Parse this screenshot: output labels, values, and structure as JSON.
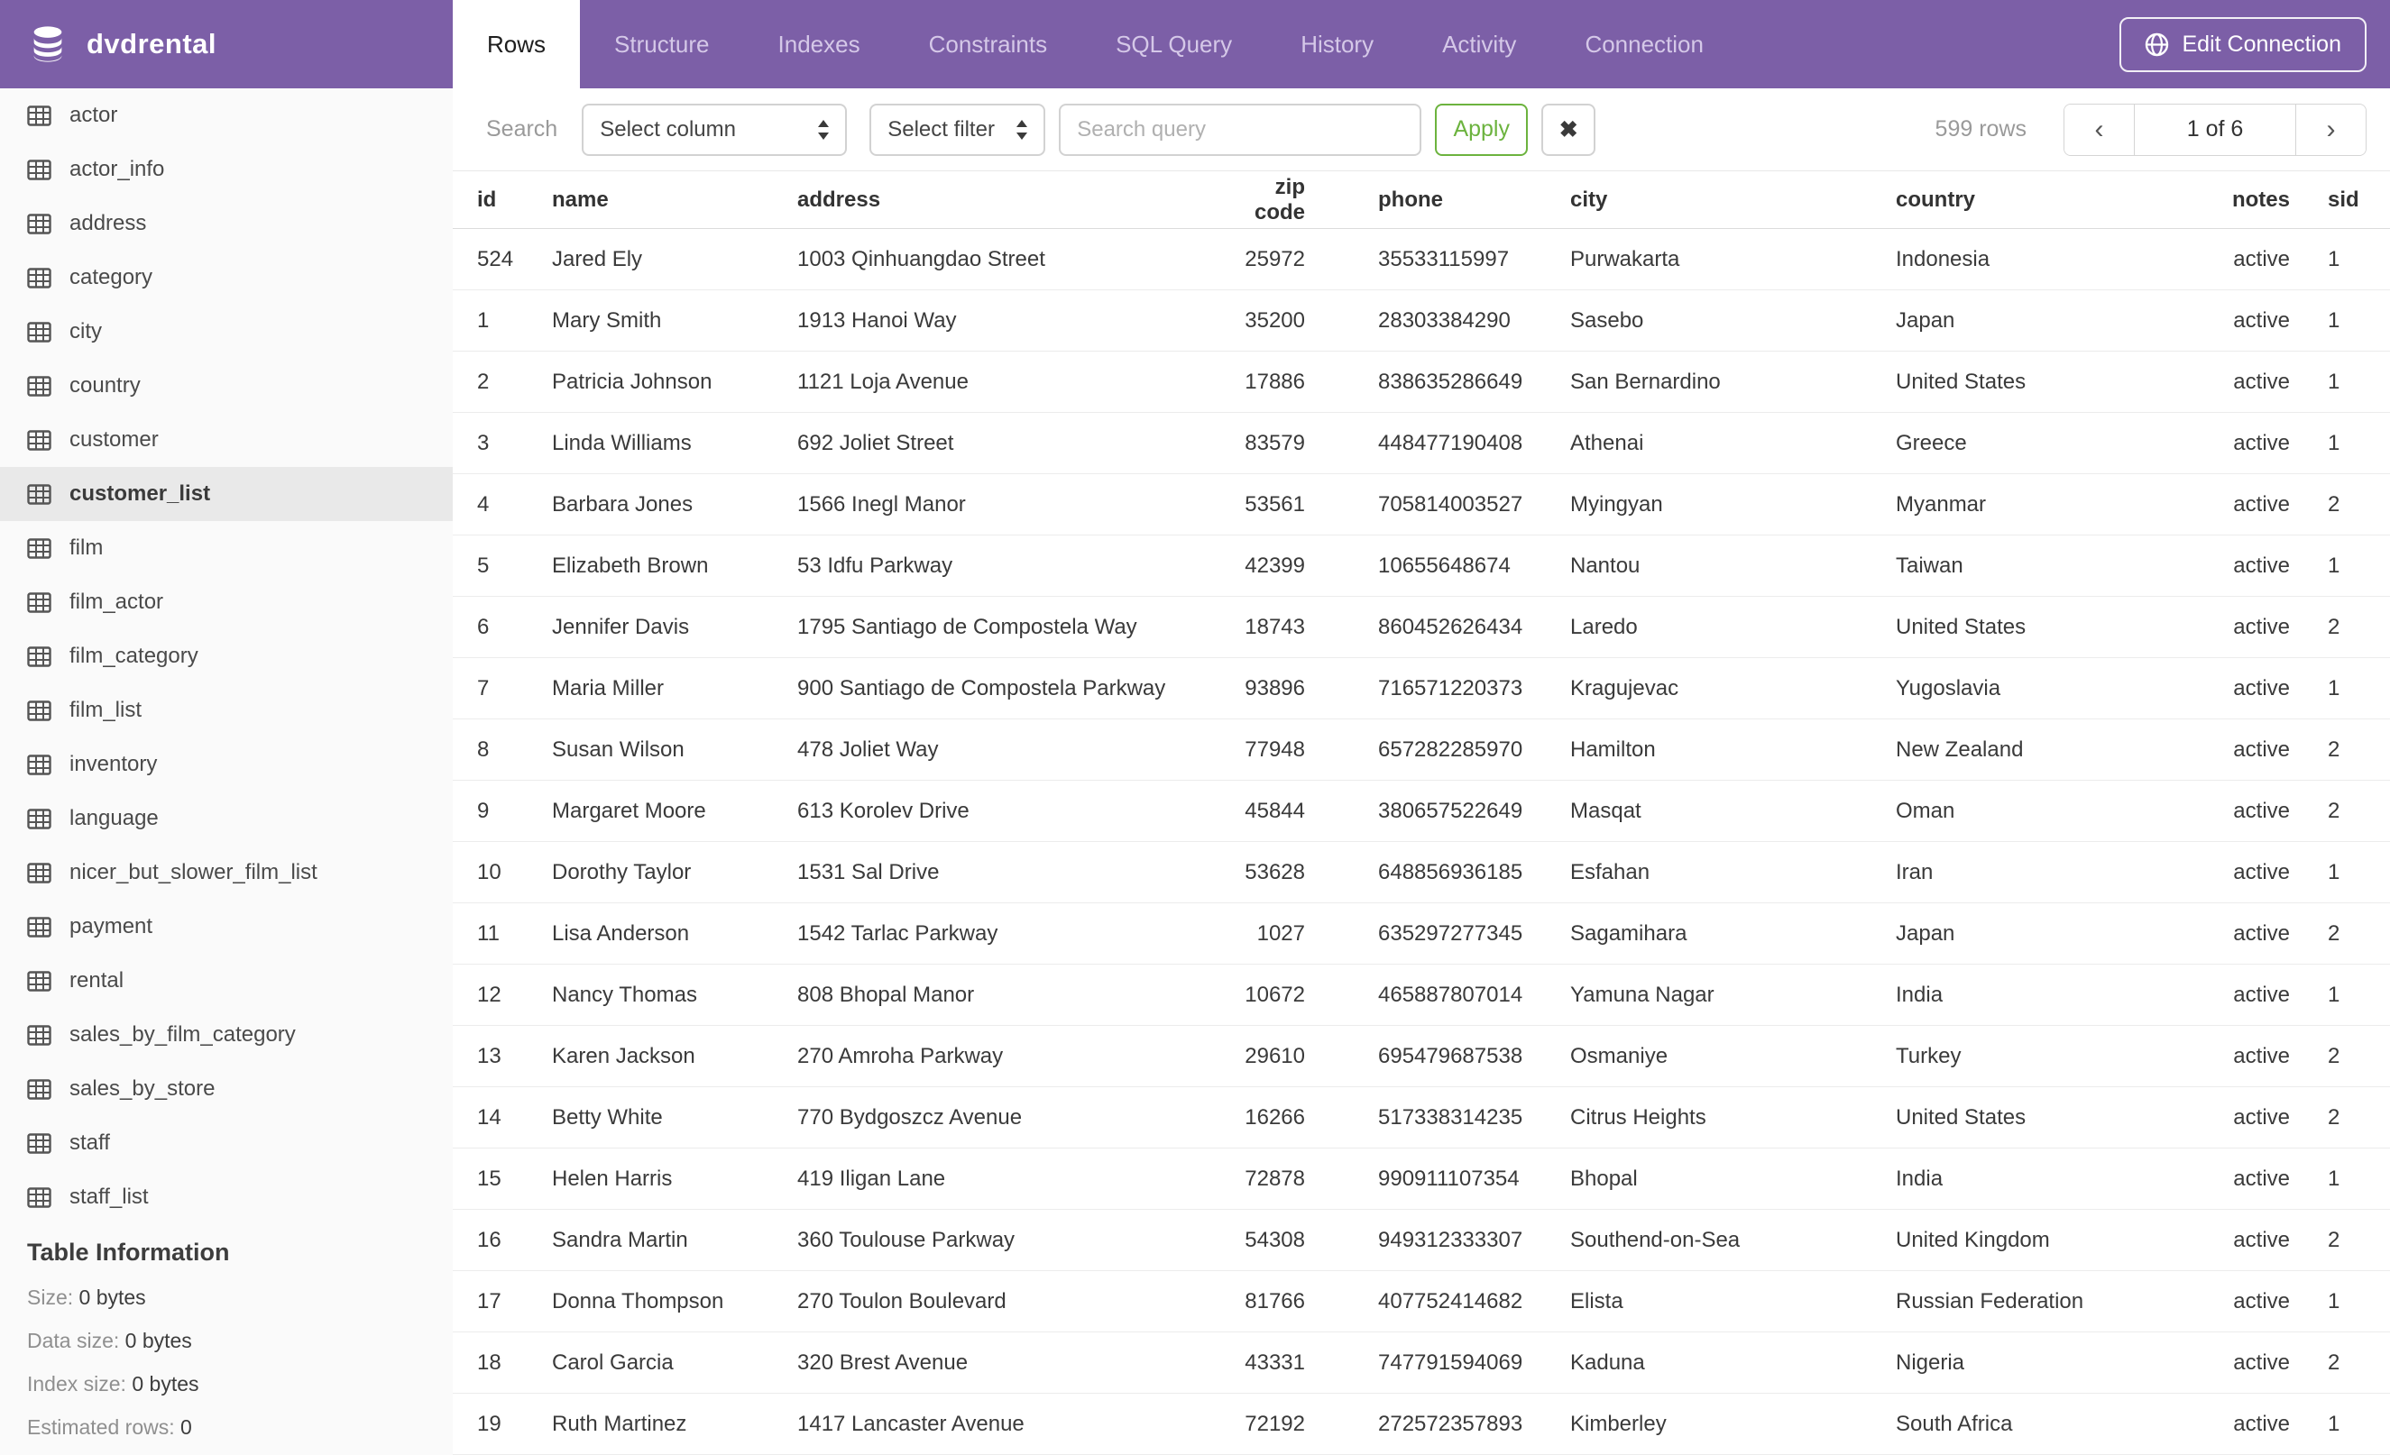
{
  "app": {
    "title": "dvdrental",
    "logo_icon": "database-icon"
  },
  "header": {
    "tabs": [
      {
        "label": "Rows",
        "active": true
      },
      {
        "label": "Structure",
        "active": false
      },
      {
        "label": "Indexes",
        "active": false
      },
      {
        "label": "Constraints",
        "active": false
      },
      {
        "label": "SQL Query",
        "active": false
      },
      {
        "label": "History",
        "active": false
      },
      {
        "label": "Activity",
        "active": false
      },
      {
        "label": "Connection",
        "active": false
      }
    ],
    "edit_connection_label": "Edit Connection",
    "edit_connection_icon": "globe-icon",
    "accent_color": "#7c5fa7"
  },
  "sidebar": {
    "item_icon": "table-grid-icon",
    "tables": [
      "actor",
      "actor_info",
      "address",
      "category",
      "city",
      "country",
      "customer",
      "customer_list",
      "film",
      "film_actor",
      "film_category",
      "film_list",
      "inventory",
      "language",
      "nicer_but_slower_film_list",
      "payment",
      "rental",
      "sales_by_film_category",
      "sales_by_store",
      "staff",
      "staff_list"
    ],
    "selected": "customer_list",
    "info": {
      "heading": "Table Information",
      "rows": [
        {
          "label": "Size:",
          "value": "0 bytes"
        },
        {
          "label": "Data size:",
          "value": "0 bytes"
        },
        {
          "label": "Index size:",
          "value": "0 bytes"
        },
        {
          "label": "Estimated rows:",
          "value": "0"
        }
      ]
    }
  },
  "toolbar": {
    "search_label": "Search",
    "column_select_value": "Select column",
    "filter_select_value": "Select filter",
    "query_placeholder": "Search query",
    "apply_label": "Apply",
    "apply_color": "#6cb33e",
    "clear_icon": "✖",
    "rows_count": "599 rows",
    "pagination": {
      "prev_icon": "‹",
      "current_page": "1 of 6",
      "next_icon": "›"
    }
  },
  "table": {
    "columns": [
      "id",
      "name",
      "address",
      "zip code",
      "phone",
      "city",
      "country",
      "notes",
      "sid"
    ],
    "rows": [
      [
        "524",
        "Jared Ely",
        "1003 Qinhuangdao Street",
        "25972",
        "35533115997",
        "Purwakarta",
        "Indonesia",
        "active",
        "1"
      ],
      [
        "1",
        "Mary Smith",
        "1913 Hanoi Way",
        "35200",
        "28303384290",
        "Sasebo",
        "Japan",
        "active",
        "1"
      ],
      [
        "2",
        "Patricia Johnson",
        "1121 Loja Avenue",
        "17886",
        "838635286649",
        "San Bernardino",
        "United States",
        "active",
        "1"
      ],
      [
        "3",
        "Linda Williams",
        "692 Joliet Street",
        "83579",
        "448477190408",
        "Athenai",
        "Greece",
        "active",
        "1"
      ],
      [
        "4",
        "Barbara Jones",
        "1566 Inegl Manor",
        "53561",
        "705814003527",
        "Myingyan",
        "Myanmar",
        "active",
        "2"
      ],
      [
        "5",
        "Elizabeth Brown",
        "53 Idfu Parkway",
        "42399",
        "10655648674",
        "Nantou",
        "Taiwan",
        "active",
        "1"
      ],
      [
        "6",
        "Jennifer Davis",
        "1795 Santiago de Compostela Way",
        "18743",
        "860452626434",
        "Laredo",
        "United States",
        "active",
        "2"
      ],
      [
        "7",
        "Maria Miller",
        "900 Santiago de Compostela Parkway",
        "93896",
        "716571220373",
        "Kragujevac",
        "Yugoslavia",
        "active",
        "1"
      ],
      [
        "8",
        "Susan Wilson",
        "478 Joliet Way",
        "77948",
        "657282285970",
        "Hamilton",
        "New Zealand",
        "active",
        "2"
      ],
      [
        "9",
        "Margaret Moore",
        "613 Korolev Drive",
        "45844",
        "380657522649",
        "Masqat",
        "Oman",
        "active",
        "2"
      ],
      [
        "10",
        "Dorothy Taylor",
        "1531 Sal Drive",
        "53628",
        "648856936185",
        "Esfahan",
        "Iran",
        "active",
        "1"
      ],
      [
        "11",
        "Lisa Anderson",
        "1542 Tarlac Parkway",
        "1027",
        "635297277345",
        "Sagamihara",
        "Japan",
        "active",
        "2"
      ],
      [
        "12",
        "Nancy Thomas",
        "808 Bhopal Manor",
        "10672",
        "465887807014",
        "Yamuna Nagar",
        "India",
        "active",
        "1"
      ],
      [
        "13",
        "Karen Jackson",
        "270 Amroha Parkway",
        "29610",
        "695479687538",
        "Osmaniye",
        "Turkey",
        "active",
        "2"
      ],
      [
        "14",
        "Betty White",
        "770 Bydgoszcz Avenue",
        "16266",
        "517338314235",
        "Citrus Heights",
        "United States",
        "active",
        "2"
      ],
      [
        "15",
        "Helen Harris",
        "419 Iligan Lane",
        "72878",
        "990911107354",
        "Bhopal",
        "India",
        "active",
        "1"
      ],
      [
        "16",
        "Sandra Martin",
        "360 Toulouse Parkway",
        "54308",
        "949312333307",
        "Southend-on-Sea",
        "United Kingdom",
        "active",
        "2"
      ],
      [
        "17",
        "Donna Thompson",
        "270 Toulon Boulevard",
        "81766",
        "407752414682",
        "Elista",
        "Russian Federation",
        "active",
        "1"
      ],
      [
        "18",
        "Carol Garcia",
        "320 Brest Avenue",
        "43331",
        "747791594069",
        "Kaduna",
        "Nigeria",
        "active",
        "2"
      ],
      [
        "19",
        "Ruth Martinez",
        "1417 Lancaster Avenue",
        "72192",
        "272572357893",
        "Kimberley",
        "South Africa",
        "active",
        "1"
      ]
    ]
  }
}
